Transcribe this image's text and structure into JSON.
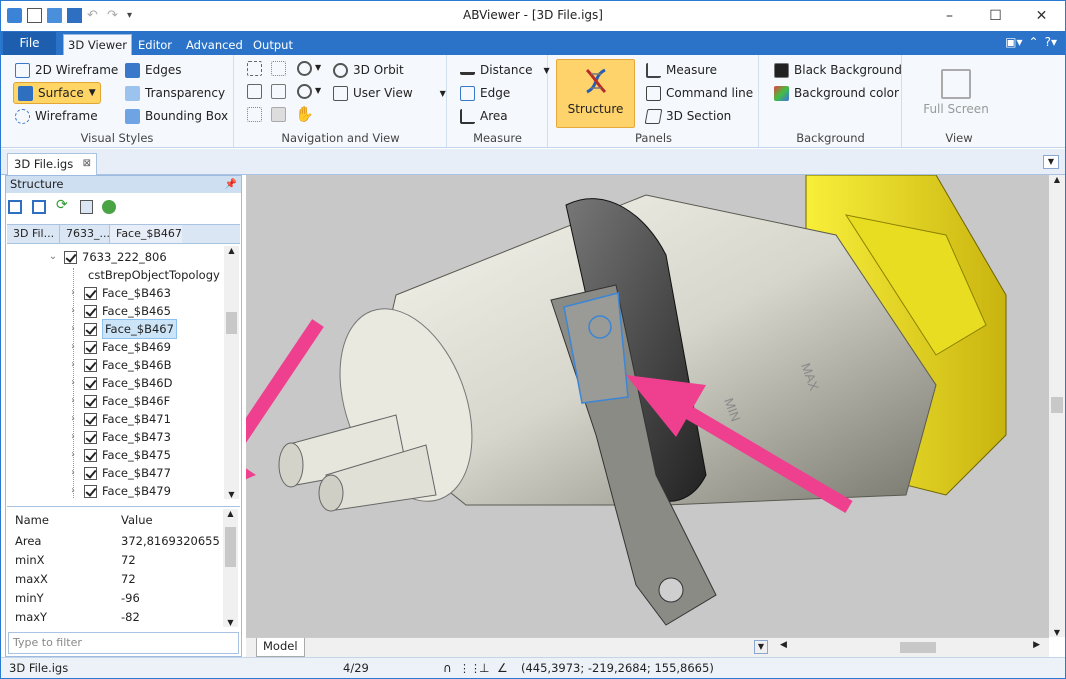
{
  "window": {
    "title": "ABViewer - [3D File.igs]"
  },
  "menu": {
    "file": "File",
    "tabs": [
      "3D Viewer",
      "Editor",
      "Advanced",
      "Output"
    ]
  },
  "ribbon": {
    "visual_styles": {
      "label": "Visual Styles",
      "items": [
        "2D Wireframe",
        "Edges",
        "Surface",
        "Transparency",
        "Wireframe",
        "Bounding Box"
      ]
    },
    "navigation": {
      "label": "Navigation and View",
      "orbit": "3D Orbit",
      "user_view": "User View"
    },
    "measure": {
      "label": "Measure",
      "items": [
        "Distance",
        "Edge",
        "Area"
      ]
    },
    "panels": {
      "label": "Panels",
      "structure": "Structure",
      "items": [
        "Measure",
        "Command line",
        "3D Section"
      ]
    },
    "background": {
      "label": "Background",
      "items": [
        "Black Background",
        "Background color"
      ]
    },
    "view": {
      "label": "View",
      "full_screen": "Full Screen"
    }
  },
  "document_tab": "3D File.igs",
  "structure": {
    "title": "Structure",
    "breadcrumbs": [
      "3D Fil...",
      "7633_...",
      "Face_$B467"
    ],
    "tree": {
      "root": "7633_222_806",
      "topology": "cstBrepObjectTopology",
      "faces": [
        "Face_$B463",
        "Face_$B465",
        "Face_$B467",
        "Face_$B469",
        "Face_$B46B",
        "Face_$B46D",
        "Face_$B46F",
        "Face_$B471",
        "Face_$B473",
        "Face_$B475",
        "Face_$B477",
        "Face_$B479"
      ],
      "selected": "Face_$B467"
    },
    "properties": {
      "headers": [
        "Name",
        "Value"
      ],
      "rows": [
        [
          "Area",
          "372,8169320655..."
        ],
        [
          "minX",
          "72"
        ],
        [
          "maxX",
          "72"
        ],
        [
          "minY",
          "-96"
        ],
        [
          "maxY",
          "-82"
        ]
      ]
    },
    "filter_placeholder": "Type to filter"
  },
  "viewport": {
    "tab": "Model",
    "model_text": [
      "MIN",
      "MAX"
    ]
  },
  "status": {
    "file": "3D File.igs",
    "page": "4/29",
    "coordinates": "(445,3973; -219,2684; 155,8665)"
  },
  "colors": {
    "ribbon_blue": "#2b73c8",
    "arrow": "#ef3f8f",
    "yellow": "#f0e21e",
    "viewport": "#c8c8c8"
  }
}
